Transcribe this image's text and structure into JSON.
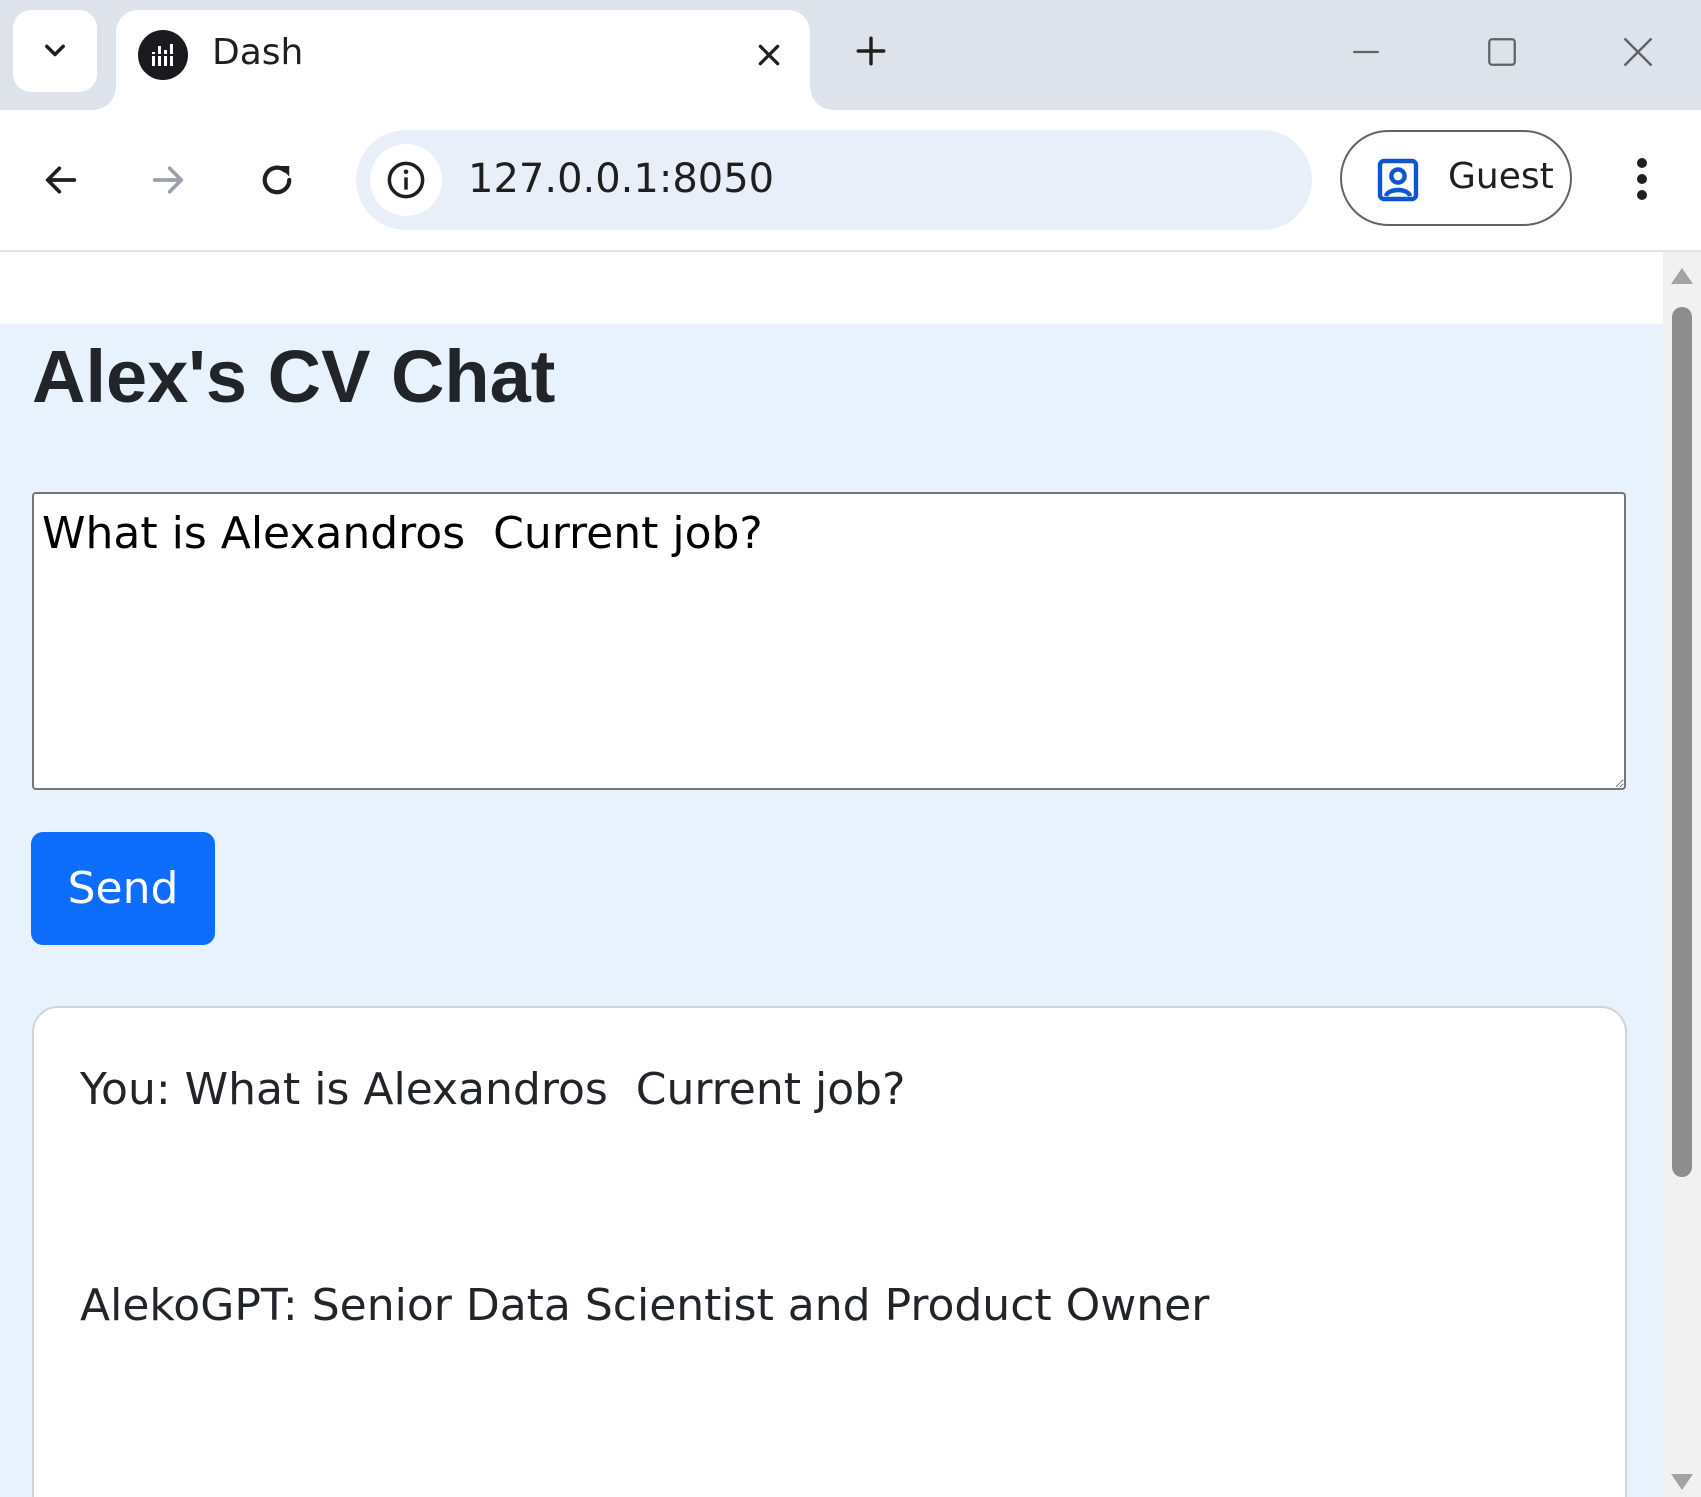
{
  "browser": {
    "tab": {
      "title": "Dash"
    },
    "address_bar": {
      "url": "127.0.0.1:8050"
    },
    "profile": {
      "label": "Guest"
    }
  },
  "app": {
    "title": "Alex's CV Chat",
    "question_input": {
      "value": "What is Alexandros  Current job?"
    },
    "send_button": {
      "label": "Send"
    },
    "chat": {
      "messages": [
        {
          "text": "You: What is Alexandros  Current job?"
        },
        {
          "text": "AlekoGPT: Senior Data Scientist and Product Owner"
        }
      ]
    }
  },
  "colors": {
    "page_background": "#e8f2fc",
    "send_button": "#0d6efd",
    "tab_strip": "#dee3eb",
    "omnibox": "#e9eff8"
  },
  "icons": [
    "tab-search-icon",
    "dash-favicon-icon",
    "close-icon",
    "plus-icon",
    "minimize-icon",
    "maximize-icon",
    "back-arrow-icon",
    "forward-arrow-icon",
    "reload-icon",
    "info-icon",
    "profile-icon",
    "more-vert-icon"
  ]
}
